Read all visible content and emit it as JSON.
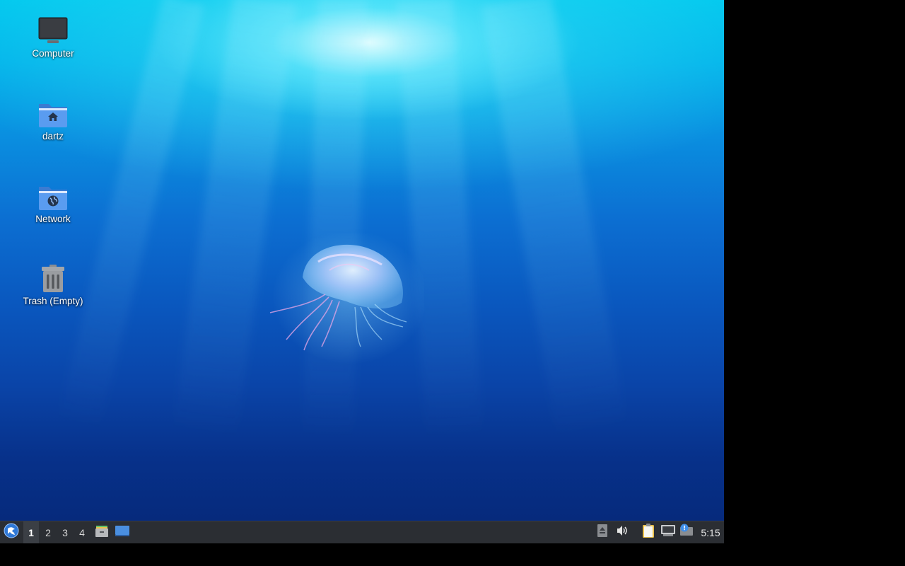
{
  "desktop": {
    "icons": [
      {
        "label": "Computer",
        "icon": "computer-icon"
      },
      {
        "label": "dartz",
        "icon": "home-folder-icon"
      },
      {
        "label": "Network",
        "icon": "network-folder-icon"
      },
      {
        "label": "Trash (Empty)",
        "icon": "trash-icon"
      }
    ]
  },
  "taskbar": {
    "menu_icon": "start-menu-icon",
    "workspaces": [
      "1",
      "2",
      "3",
      "4"
    ],
    "active_workspace": "1",
    "launchers": [
      "file-manager-icon",
      "show-desktop-icon"
    ],
    "tray": [
      "eject-icon",
      "volume-icon",
      "clipboard-icon",
      "network-wired-icon",
      "update-notifier-icon"
    ],
    "clock": "5:15"
  },
  "colors": {
    "panel": "#2b2e33",
    "folder_blue": "#4a8fe0",
    "water_top": "#00c8ee",
    "water_bottom": "#062a7c"
  }
}
